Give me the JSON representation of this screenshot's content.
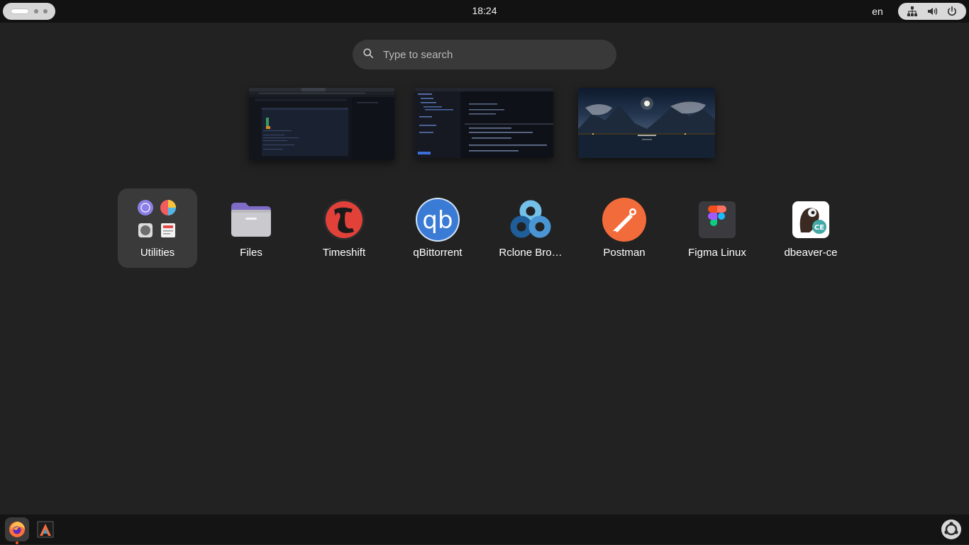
{
  "topbar": {
    "clock": "18:24",
    "language": "en"
  },
  "search": {
    "placeholder": "Type to search"
  },
  "apps": [
    {
      "label": "Utilities",
      "icon": "utilities-folder-icon"
    },
    {
      "label": "Files",
      "icon": "files-folder-icon"
    },
    {
      "label": "Timeshift",
      "icon": "timeshift-icon"
    },
    {
      "label": "qBittorrent",
      "icon": "qbittorrent-icon"
    },
    {
      "label": "Rclone Bro…",
      "icon": "rclone-browser-icon"
    },
    {
      "label": "Postman",
      "icon": "postman-icon"
    },
    {
      "label": "Figma Linux",
      "icon": "figma-icon"
    },
    {
      "label": "dbeaver-ce",
      "icon": "dbeaver-icon"
    }
  ],
  "qbittorrent_icon_text": "qb",
  "dock": {
    "items": [
      "firefox-icon",
      "alacritty-icon"
    ],
    "show_apps": "show-apps-icon"
  },
  "colors": {
    "background": "#222222",
    "topbar": "#121212",
    "accent": "#e95420",
    "selected_tile": "#3a3a3a"
  }
}
